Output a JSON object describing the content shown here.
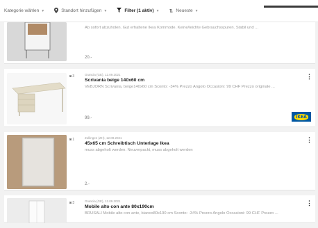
{
  "filters": {
    "category": "Kategorie wählen",
    "location": "Standort hinzufügen",
    "filter": "Filter (1 aktiv)",
    "sort": "Neueste"
  },
  "listings": [
    {
      "date": "",
      "title": "",
      "description": "Ab sofort abzuholen. Gut erhaltene Ikea Kommode. Keine/leichte Gebrauchsspuren. Stabil und ...",
      "price": "20.-",
      "photo_count": ""
    },
    {
      "date": "Grancia (GE), 12.09.2021",
      "title": "Scrivania beige 140x60 cm",
      "description": "VEBJÖRN Scrivania, beige140x60 cm Sconto: -34% Prezzo Angolo Occasioni: 99 CHF Prezzo originale ...",
      "price": "99.-",
      "photo_count": "3",
      "brand": "IKEA"
    },
    {
      "date": "Zollingen (ZH), 12.09.2021",
      "title": "45x65 cm Schreibtisch Unterlage Ikea",
      "description": "muss abgeholt werden. Neuverpackt, muss abgeholt werden",
      "price": "2.-",
      "photo_count": "1"
    },
    {
      "date": "Grancia (GE), 12.09.2021",
      "title": "Mobile alto con ante 80x190cm",
      "description": "BRUSALI Mobile alto con ante, bianco80x190 cm Sconto: -34% Prezzo Angolo Occasioni: 99 CHF Prezzo ...",
      "price": "",
      "photo_count": "3"
    }
  ],
  "colors": {
    "ikea_blue": "#0058a3",
    "ikea_yellow": "#ffdb00"
  }
}
